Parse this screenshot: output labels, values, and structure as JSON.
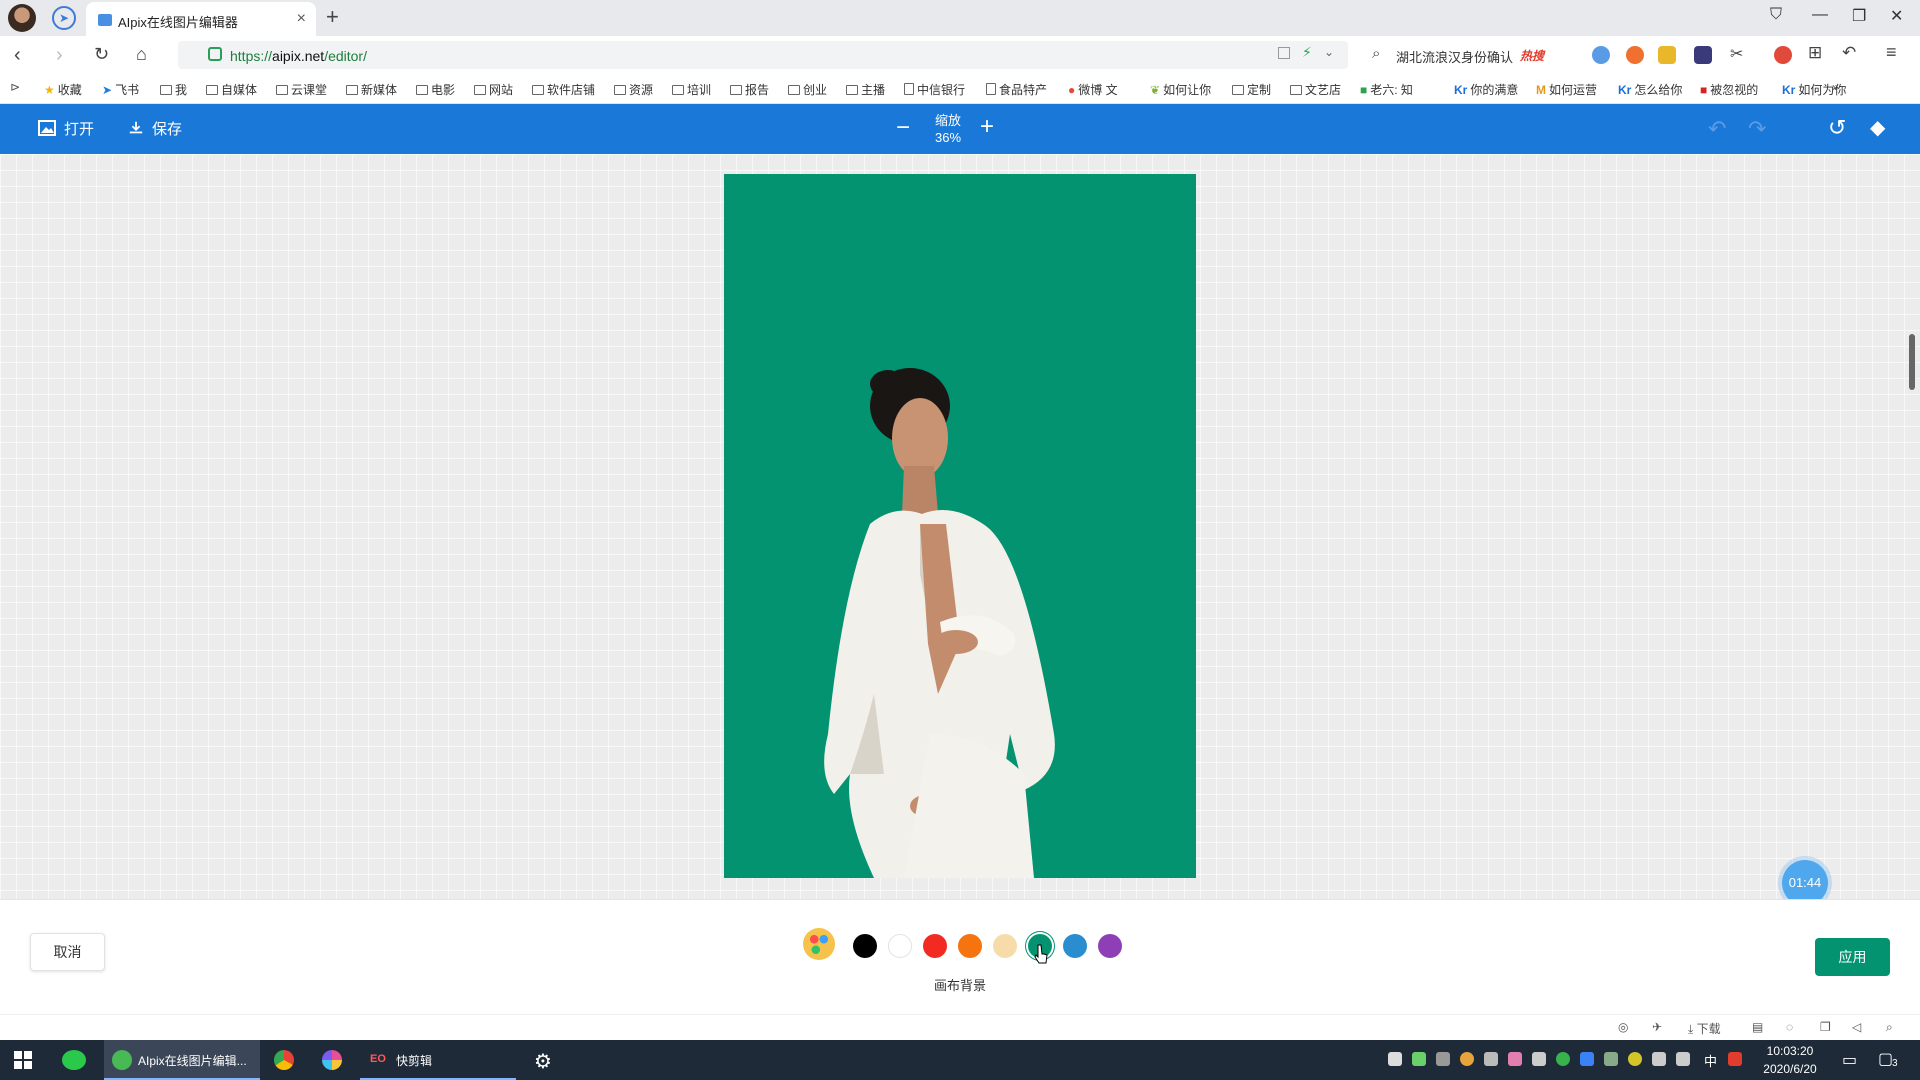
{
  "browser": {
    "tab_title": "AIpix在线图片编辑器",
    "url_scheme": "https://",
    "url_host": "aipix.net",
    "url_path": "/editor/",
    "search_text": "湖北流浪汉身份确认",
    "search_badge": "热搜"
  },
  "bookmarks": [
    {
      "label": "收藏",
      "icon": "star-icon"
    },
    {
      "label": "飞书",
      "icon": "paper-plane-icon"
    },
    {
      "label": "我",
      "icon": "folder-icon"
    },
    {
      "label": "自媒体",
      "icon": "folder-icon"
    },
    {
      "label": "云课堂",
      "icon": "folder-icon"
    },
    {
      "label": "新媒体",
      "icon": "folder-icon"
    },
    {
      "label": "电影",
      "icon": "folder-icon"
    },
    {
      "label": "网站",
      "icon": "folder-icon"
    },
    {
      "label": "软件店铺",
      "icon": "folder-icon"
    },
    {
      "label": "资源",
      "icon": "folder-icon"
    },
    {
      "label": "培训",
      "icon": "folder-icon"
    },
    {
      "label": "报告",
      "icon": "folder-icon"
    },
    {
      "label": "创业",
      "icon": "folder-icon"
    },
    {
      "label": "主播",
      "icon": "folder-icon"
    },
    {
      "label": "中信银行",
      "icon": "page-icon"
    },
    {
      "label": "食品特产",
      "icon": "page-icon"
    },
    {
      "label": "微博 文",
      "icon": "weibo-icon"
    },
    {
      "label": "如何让你",
      "icon": "leaf-icon"
    },
    {
      "label": "定制",
      "icon": "folder-icon"
    },
    {
      "label": "文艺店",
      "icon": "folder-icon"
    },
    {
      "label": "老六: 知",
      "icon": "green-square-icon"
    },
    {
      "label": "你的满意",
      "icon": "kr-icon"
    },
    {
      "label": "如何运营",
      "icon": "m-icon"
    },
    {
      "label": "怎么给你",
      "icon": "kr-icon"
    },
    {
      "label": "被忽视的",
      "icon": "red-square-icon"
    },
    {
      "label": "如何为你",
      "icon": "kr-icon"
    }
  ],
  "toolbar": {
    "open_label": "打开",
    "save_label": "保存",
    "zoom_label": "缩放",
    "zoom_value": "36%"
  },
  "canvas": {
    "background_color": "#039370",
    "timer": "01:44"
  },
  "bottom": {
    "cancel_label": "取消",
    "apply_label": "应用",
    "caption": "画布背景",
    "swatches": [
      "#000000",
      "#ffffff",
      "#f22a22",
      "#f5740f",
      "#f7dcaa",
      "#039370",
      "#2a8dd0",
      "#8e3fb6"
    ],
    "selected_swatch": "#039370"
  },
  "status_strip": {
    "download_label": "下载"
  },
  "taskbar": {
    "active_app_label": "AIpix在线图片编辑...",
    "kuaijian_label": "快剪辑",
    "kuaijian_icon_text": "EO",
    "time": "10:03:20",
    "date": "2020/6/20",
    "ime": "中",
    "notifications": "3"
  }
}
